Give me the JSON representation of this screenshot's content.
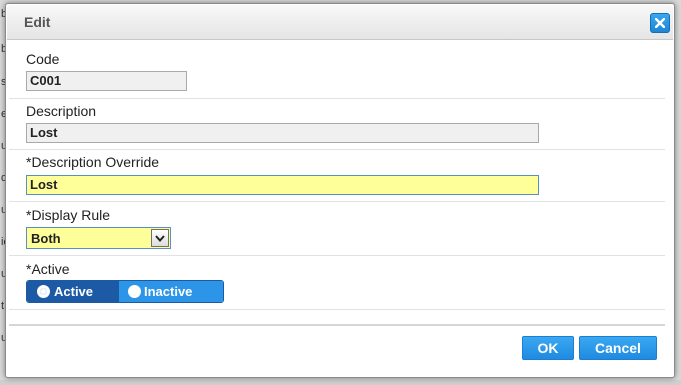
{
  "background": {
    "edge_letters": [
      "b",
      "b",
      "s",
      "e",
      "u",
      "d",
      "u",
      "ic",
      "u",
      "t",
      "u"
    ]
  },
  "dialog": {
    "title": "Edit",
    "close_icon": "close-icon"
  },
  "form": {
    "code": {
      "label": "Code",
      "value": "C001"
    },
    "description": {
      "label": "Description",
      "value": "Lost"
    },
    "description_override": {
      "label": "*Description Override",
      "value": "Lost"
    },
    "display_rule": {
      "label": "*Display Rule",
      "value": "Both",
      "arrow_icon": "chevron-down-icon"
    },
    "active": {
      "label": "*Active",
      "options": [
        {
          "label": "Active",
          "selected": true
        },
        {
          "label": "Inactive",
          "selected": false
        }
      ]
    }
  },
  "buttons": {
    "ok": "OK",
    "cancel": "Cancel"
  },
  "colors": {
    "accent": "#2d95e8",
    "accent_dark": "#1c5aa6",
    "editable_field": "#ffff99"
  }
}
